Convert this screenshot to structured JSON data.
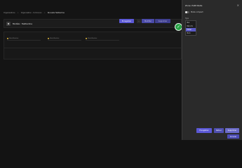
{
  "breadcrumb": {
    "items": [
      "Organisations",
      "Organisation - tochooran",
      "Nouvelle Testbarline"
    ],
    "separator": ">"
  },
  "header": {
    "title": "Modèle : Testbarline"
  },
  "toolbar": {
    "save_label": "Enregistrer",
    "more_label": "…",
    "edit_label": "Modifier",
    "delete_label": "Supprimer"
  },
  "content": {
    "fields": [
      {
        "label": "Identification"
      },
      {
        "label": "Identification"
      },
      {
        "label": "Identification"
      }
    ]
  },
  "drawer": {
    "title": "Zone d'attribute",
    "close": "×",
    "toggle_label": "Mode compact",
    "type_label": "Type",
    "options": [
      "Nul",
      "Récurrs",
      "Entier",
      "Num"
    ],
    "selected_index": 2,
    "buttons": {
      "save": "Enregistrer",
      "back": "Retour",
      "delete": "Supprimer",
      "cancel": "Annuler"
    }
  },
  "colors": {
    "accent": "#5b58d6",
    "success": "#25a244",
    "background": "#141414",
    "drawer": "#2a2a2a"
  }
}
